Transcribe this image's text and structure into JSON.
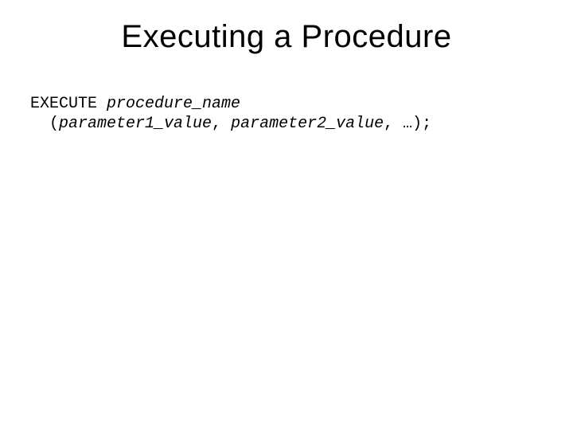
{
  "slide": {
    "title": "Executing a Procedure",
    "code": {
      "kw_execute": "EXECUTE ",
      "proc_name": "procedure_name",
      "l2_indent": "  (",
      "param1": "parameter1_value",
      "sep1": ", ",
      "param2": "parameter2_value",
      "tail": ", …);"
    }
  }
}
